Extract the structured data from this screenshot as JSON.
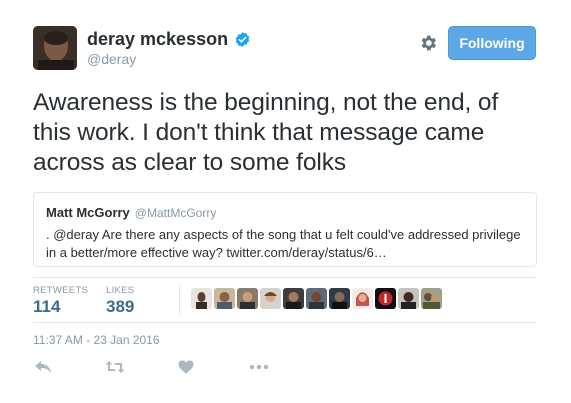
{
  "author": {
    "display_name": "deray mckesson",
    "handle": "@deray",
    "verified": true
  },
  "follow_button": {
    "label": "Following"
  },
  "tweet": {
    "text": "Awareness is the beginning, not the end, of this work. I don't think that message came across as clear to some folks"
  },
  "quoted_tweet": {
    "author_name": "Matt McGorry",
    "author_handle": "@MattMcGorry",
    "text": ". @deray Are there any aspects of the song that u felt could've addressed privilege in a better/more effective way?  twitter.com/deray/status/6…"
  },
  "stats": {
    "retweets_label": "RETWEETS",
    "retweets_count": "114",
    "likes_label": "LIKES",
    "likes_count": "389"
  },
  "timestamp": "11:37 AM - 23 Jan 2016",
  "colors": {
    "accent": "#5ca8e6",
    "verified": "#1da1f2",
    "muted": "#8899a6",
    "stat_value": "#3d6d8a"
  },
  "icons": {
    "settings": "gear-icon",
    "reply": "reply-icon",
    "retweet": "retweet-icon",
    "like": "heart-icon",
    "more": "more-icon",
    "verified": "verified-badge-icon"
  }
}
